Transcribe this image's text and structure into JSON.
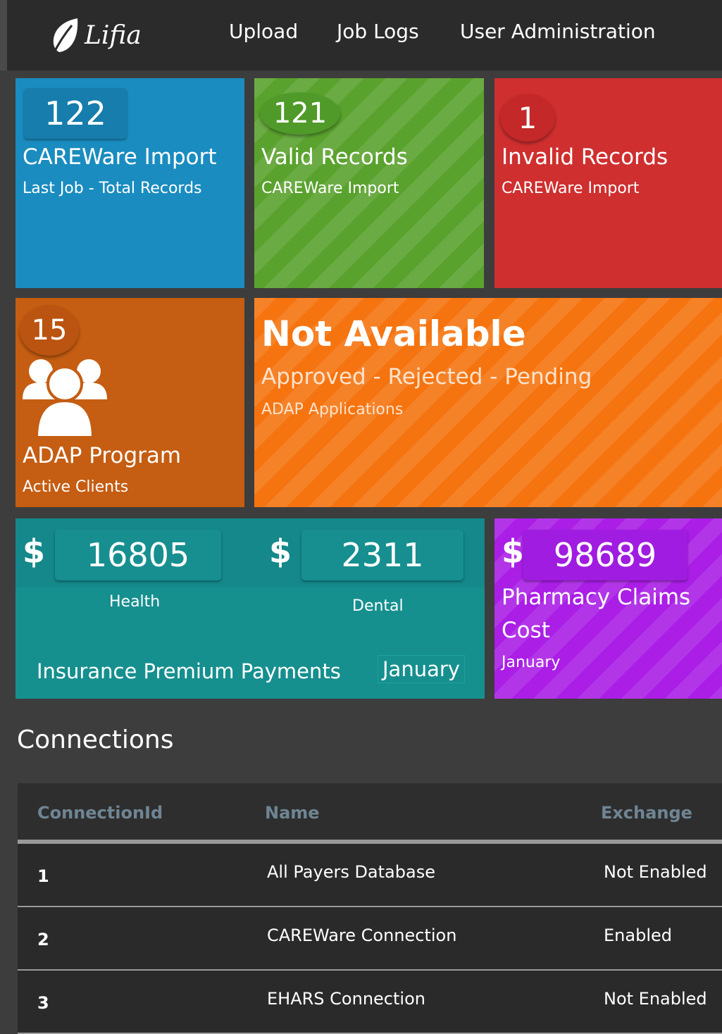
{
  "app": {
    "logo_text": "Lifia"
  },
  "nav": {
    "upload": "Upload",
    "job_logs": "Job Logs",
    "user_admin": "User Administration"
  },
  "tiles": {
    "careware": {
      "count": "122",
      "title": "CAREWare Import",
      "subtitle": "Last Job - Total Records",
      "color": "#1a8cc0"
    },
    "valid": {
      "count": "121",
      "title": "Valid Records",
      "subtitle": "CAREWare Import",
      "color": "#5aa22e"
    },
    "invalid": {
      "count": "1",
      "title": "Invalid Records",
      "subtitle": "CAREWare Import",
      "color": "#cf2f2f"
    },
    "adap": {
      "count": "15",
      "title": "ADAP Program",
      "subtitle": "Active Clients",
      "icon": "users-icon",
      "color": "#c55d12"
    },
    "applications": {
      "heading": "Not Available",
      "title": "Approved - Rejected - Pending",
      "subtitle": "ADAP Applications",
      "color": "#f57410"
    },
    "insurance": {
      "currency": "$",
      "health_value": "16805",
      "health_label": "Health",
      "dental_value": "2311",
      "dental_label": "Dental",
      "title": "Insurance Premium Payments",
      "month": "January",
      "color": "#168f8f"
    },
    "pharmacy": {
      "currency": "$",
      "value": "98689",
      "title_line1": "Pharmacy Claims",
      "title_line2": "Cost",
      "month": "January",
      "color": "#aa1ee6"
    }
  },
  "connections": {
    "title": "Connections",
    "columns": [
      "ConnectionId",
      "Name",
      "Exchange"
    ],
    "rows": [
      {
        "id": "1",
        "name": "All Payers Database",
        "exchange": "Not Enabled"
      },
      {
        "id": "2",
        "name": "CAREWare Connection",
        "exchange": "Enabled"
      },
      {
        "id": "3",
        "name": "EHARS Connection",
        "exchange": "Not Enabled"
      }
    ]
  }
}
